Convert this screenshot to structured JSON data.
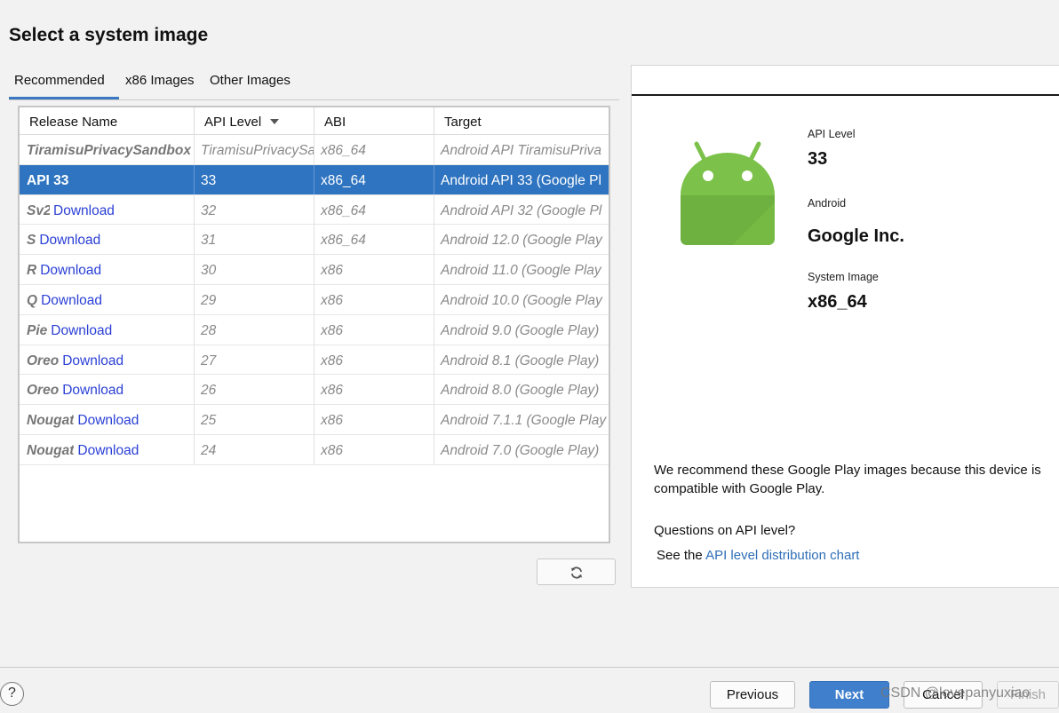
{
  "page_title": "Select a system image",
  "tabs": [
    {
      "label": "Recommended",
      "active": true
    },
    {
      "label": "x86 Images",
      "active": false
    },
    {
      "label": "Other Images",
      "active": false
    }
  ],
  "table": {
    "headers": {
      "name": "Release Name",
      "api": "API Level",
      "abi": "ABI",
      "target": "Target"
    },
    "sort_icon": "sort-descending-icon",
    "download_label": "Download",
    "rows": [
      {
        "name": "TiramisuPrivacySandbox",
        "download": false,
        "api": "TiramisuPrivacySa",
        "abi": "x86_64",
        "target": "Android API TiramisuPriva",
        "selected": false
      },
      {
        "name": "API 33",
        "download": false,
        "api": "33",
        "abi": "x86_64",
        "target": "Android API 33 (Google Pl",
        "selected": true
      },
      {
        "name": "Sv2",
        "download": true,
        "api": "32",
        "abi": "x86_64",
        "target": "Android API 32 (Google Pl",
        "selected": false
      },
      {
        "name": "S",
        "download": true,
        "api": "31",
        "abi": "x86_64",
        "target": "Android 12.0 (Google Play",
        "selected": false
      },
      {
        "name": "R",
        "download": true,
        "api": "30",
        "abi": "x86",
        "target": "Android 11.0 (Google Play",
        "selected": false
      },
      {
        "name": "Q",
        "download": true,
        "api": "29",
        "abi": "x86",
        "target": "Android 10.0 (Google Play",
        "selected": false
      },
      {
        "name": "Pie",
        "download": true,
        "api": "28",
        "abi": "x86",
        "target": "Android 9.0 (Google Play)",
        "selected": false
      },
      {
        "name": "Oreo",
        "download": true,
        "api": "27",
        "abi": "x86",
        "target": "Android 8.1 (Google Play)",
        "selected": false
      },
      {
        "name": "Oreo",
        "download": true,
        "api": "26",
        "abi": "x86",
        "target": "Android 8.0 (Google Play)",
        "selected": false
      },
      {
        "name": "Nougat",
        "download": true,
        "api": "25",
        "abi": "x86",
        "target": "Android 7.1.1 (Google Play",
        "selected": false
      },
      {
        "name": "Nougat",
        "download": true,
        "api": "24",
        "abi": "x86",
        "target": "Android 7.0 (Google Play)",
        "selected": false
      }
    ]
  },
  "refresh_icon": "refresh-icon",
  "details": {
    "logo_icon": "android-logo-icon",
    "api_level_label": "API Level",
    "api_level_value": "33",
    "android_label": "Android",
    "vendor_value": "Google Inc.",
    "system_image_label": "System Image",
    "system_image_value": "x86_64",
    "recommend_text": "We recommend these Google Play images because this device is compatible with Google Play.",
    "question_text": "Questions on API level?",
    "see_text": "See the ",
    "chart_link": "API level distribution chart"
  },
  "footer": {
    "help_label": "?",
    "previous_label": "Previous",
    "next_label": "Next",
    "cancel_label": "Cancel",
    "finish_label": "Finish"
  },
  "watermark": "CSDN @lovepanyuxiao",
  "colors": {
    "selection": "#2f74c0",
    "link": "#2a3fd6",
    "android_green": "#7cc24a",
    "primary_button": "#3f7fcc"
  }
}
